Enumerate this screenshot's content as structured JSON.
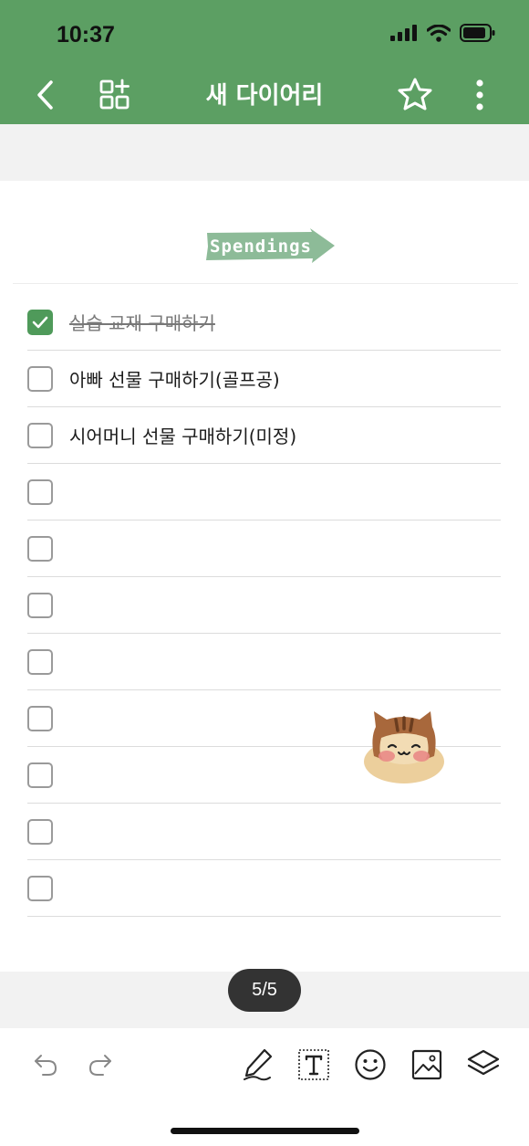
{
  "status_bar": {
    "time": "10:37"
  },
  "nav": {
    "title": "새 다이어리"
  },
  "banner": {
    "text": "Spendings"
  },
  "checklist": [
    {
      "label": "실습 교재 구매하기",
      "checked": true
    },
    {
      "label": "아빠 선물 구매하기(골프공)",
      "checked": false
    },
    {
      "label": "시어머니 선물 구매하기(미정)",
      "checked": false
    },
    {
      "label": "",
      "checked": false
    },
    {
      "label": "",
      "checked": false
    },
    {
      "label": "",
      "checked": false
    },
    {
      "label": "",
      "checked": false
    },
    {
      "label": "",
      "checked": false
    },
    {
      "label": "",
      "checked": false
    },
    {
      "label": "",
      "checked": false
    },
    {
      "label": "",
      "checked": false
    }
  ],
  "pager": {
    "label": "5/5"
  },
  "icons": {
    "back": "chevron-left-icon",
    "add_page": "grid-plus-icon",
    "favorite": "star-icon",
    "more": "more-vertical-icon",
    "undo": "undo-icon",
    "redo": "redo-icon",
    "pen": "pen-icon",
    "text": "text-box-icon",
    "emoji": "smiley-icon",
    "image": "image-icon",
    "layers": "layers-icon"
  },
  "colors": {
    "header": "#5c9f63",
    "checked": "#4f9a5a",
    "banner": "#8dbb98"
  }
}
